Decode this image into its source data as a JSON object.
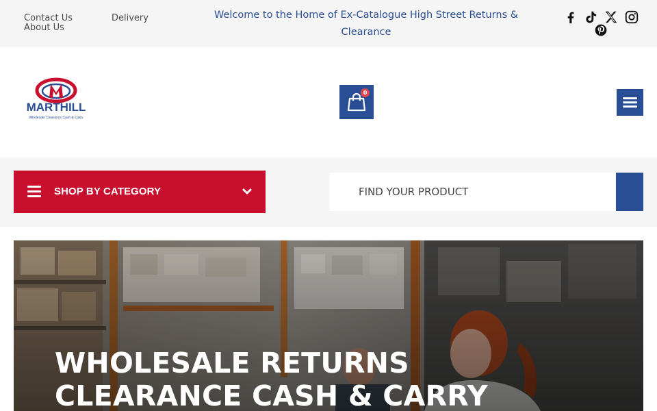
{
  "topbar": {
    "links": {
      "contact": "Contact Us",
      "about": "About Us",
      "delivery": "Delivery"
    },
    "welcome": "Welcome to the Home of Ex-Catalogue High Street Returns & Clearance",
    "social_icons": [
      "facebook-icon",
      "tiktok-icon",
      "x-icon",
      "instagram-icon",
      "pinterest-icon"
    ]
  },
  "header": {
    "logo": {
      "letter": "M",
      "brand": "MARTHILL",
      "tagline": "Wholesale Clearance Cash & Carry"
    },
    "cart": {
      "count": "0",
      "icon": "shopping-bag-icon"
    },
    "menu": {
      "icon": "hamburger-icon"
    }
  },
  "category": {
    "label": "SHOP BY CATEGORY",
    "icon": "menu-lines-icon",
    "chevron_icon": "chevron-down-icon"
  },
  "search": {
    "placeholder": "FIND YOUR PRODUCT",
    "button_icon": "search-icon"
  },
  "hero": {
    "title_line1": "WHOLESALE RETURNS",
    "title_line2": "CLEARANCE CASH & CARRY"
  },
  "colors": {
    "brand_blue": "#2a4e96",
    "brand_red": "#c8102e",
    "topbar_bg": "#f5f5f5",
    "badge_red": "#e0454f"
  }
}
